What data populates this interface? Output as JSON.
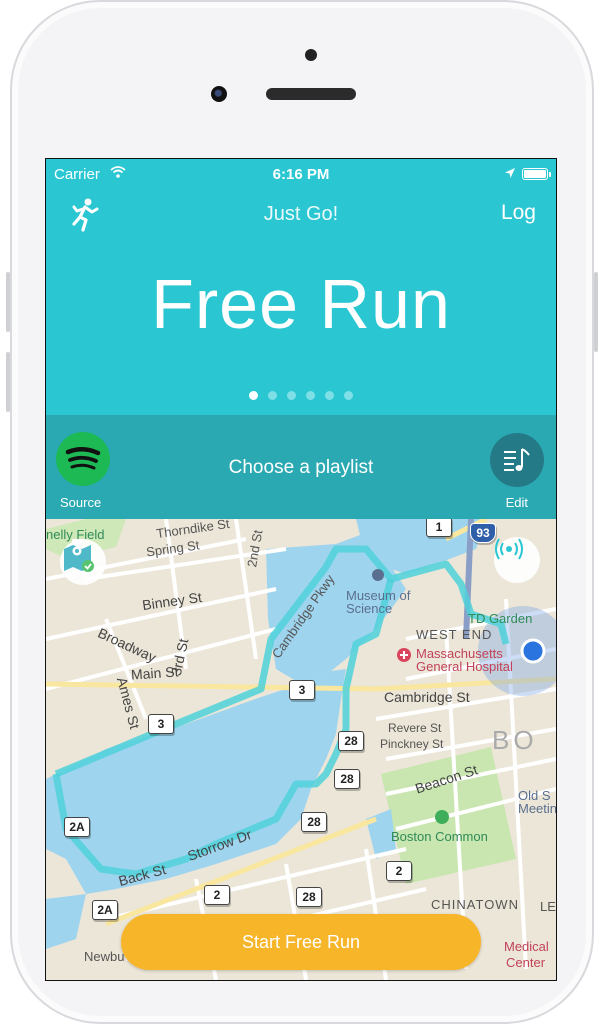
{
  "status": {
    "carrier": "Carrier",
    "time": "6:16 PM"
  },
  "header": {
    "title": "Just Go!",
    "log_label": "Log"
  },
  "mode": {
    "title": "Free Run",
    "page_count": 6,
    "active_page": 0
  },
  "music": {
    "source_label": "Source",
    "prompt": "Choose a playlist",
    "edit_label": "Edit"
  },
  "map": {
    "labels": {
      "field": "nelly Field",
      "thorndike": "Thorndike St",
      "spring": "Spring St",
      "second": "2nd St",
      "binney": "Binney St",
      "broadway": "Broadway",
      "third": "3rd St",
      "main": "Main St",
      "ames": "Ames St",
      "cambridgepkwy": "Cambridge Pkwy",
      "museum": "Museum of Science",
      "tdgarden": "TD Garden",
      "westend": "WEST END",
      "mgh": "Massachusetts General Hospital",
      "cambridgest": "Cambridge St",
      "revere": "Revere St",
      "pinckney": "Pinckney St",
      "bos": "BO",
      "beacon": "Beacon St",
      "oldstate": "Old S Meeting",
      "common": "Boston Common",
      "storrow": "Storrow Dr",
      "back": "Back St",
      "chinatown": "CHINATOWN",
      "newbury": "Newbu",
      "medical": "Medical",
      "center": "Center",
      "le": "LE"
    },
    "shields": [
      "1",
      "93",
      "3",
      "3",
      "28",
      "28",
      "2A",
      "28",
      "2",
      "2",
      "28",
      "2A"
    ]
  },
  "cta": {
    "start_label": "Start Free Run"
  },
  "colors": {
    "accent": "#2ac7d3",
    "music_bar": "#2aa9b3",
    "cta": "#f7b52a",
    "route": "#4fd1d9",
    "spotify": "#1db954"
  }
}
